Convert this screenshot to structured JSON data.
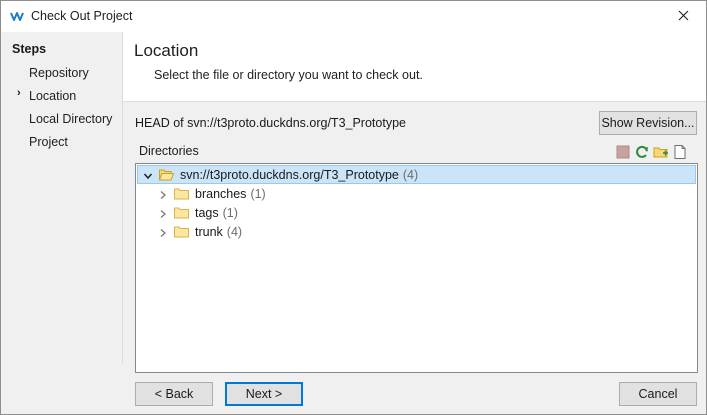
{
  "window": {
    "title": "Check Out Project",
    "close_icon": "close-icon",
    "app_icon": "svn-logo-icon"
  },
  "sidebar": {
    "title": "Steps",
    "current_marker": "›",
    "steps": [
      {
        "label": "Repository"
      },
      {
        "label": "Location"
      },
      {
        "label": "Local Directory"
      },
      {
        "label": "Project"
      }
    ],
    "current_index": 1
  },
  "header": {
    "title": "Location",
    "description": "Select the file or directory you want to check out."
  },
  "content": {
    "head_label": "HEAD of svn://t3proto.duckdns.org/T3_Prototype",
    "show_revision_label": "Show Revision...",
    "directories_label": "Directories",
    "toolbar_icons": [
      "stop-icon",
      "refresh-icon",
      "new-folder-icon",
      "new-file-icon"
    ],
    "tree": {
      "root": {
        "label": "svn://t3proto.duckdns.org/T3_Prototype",
        "count": "(4)",
        "expanded": true,
        "selected": true
      },
      "children": [
        {
          "label": "branches",
          "count": "(1)"
        },
        {
          "label": "tags",
          "count": "(1)"
        },
        {
          "label": "trunk",
          "count": "(4)"
        }
      ]
    }
  },
  "buttons": {
    "back": "< Back",
    "next": "Next >",
    "cancel": "Cancel"
  },
  "colors": {
    "selection_bg": "#cce4f7",
    "selection_border": "#99c9ef",
    "default_button_border": "#0078d7",
    "folder_fill": "#f8d775"
  }
}
